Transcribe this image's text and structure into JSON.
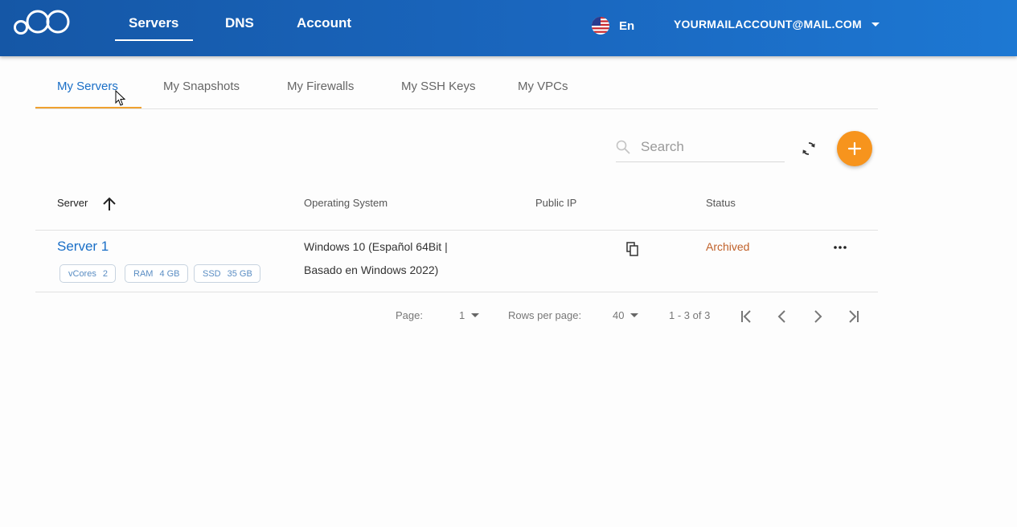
{
  "header": {
    "nav": [
      {
        "label": "Servers",
        "active": true
      },
      {
        "label": "DNS"
      },
      {
        "label": "Account"
      }
    ],
    "language": {
      "label": "En",
      "flag_icon": "us-flag-icon"
    },
    "account_email": "YOURMAILACCOUNT@MAIL.COM"
  },
  "tabs": [
    {
      "label": "My Servers",
      "active": true
    },
    {
      "label": "My Snapshots"
    },
    {
      "label": "My Firewalls"
    },
    {
      "label": "My SSH Keys"
    },
    {
      "label": "My VPCs"
    }
  ],
  "toolbar": {
    "search_placeholder": "Search",
    "refresh_icon": "refresh-icon",
    "add_icon": "plus-icon"
  },
  "table": {
    "columns": [
      "Server",
      "Operating System",
      "Public IP",
      "Status"
    ],
    "sort": {
      "column": "Server",
      "direction": "ascending"
    },
    "rows": [
      {
        "name": "Server 1",
        "specs": [
          {
            "label": "vCores",
            "value": "2"
          },
          {
            "label": "RAM",
            "value": "4 GB"
          },
          {
            "label": "SSD",
            "value": "35 GB"
          }
        ],
        "os_line1": "Windows 10 (Español 64Bit |",
        "os_line2": "Basado en Windows 2022)",
        "public_ip": "",
        "status": "Archived"
      }
    ]
  },
  "pagination": {
    "page_label": "Page:",
    "page_value": "1",
    "rows_label": "Rows per page:",
    "rows_value": "40",
    "range": "1 - 3 of 3"
  },
  "colors": {
    "header_blue": "#1a67bf",
    "accent_orange": "#f7941d",
    "link_blue": "#1a6fc7",
    "status_archived": "#c0612a"
  }
}
